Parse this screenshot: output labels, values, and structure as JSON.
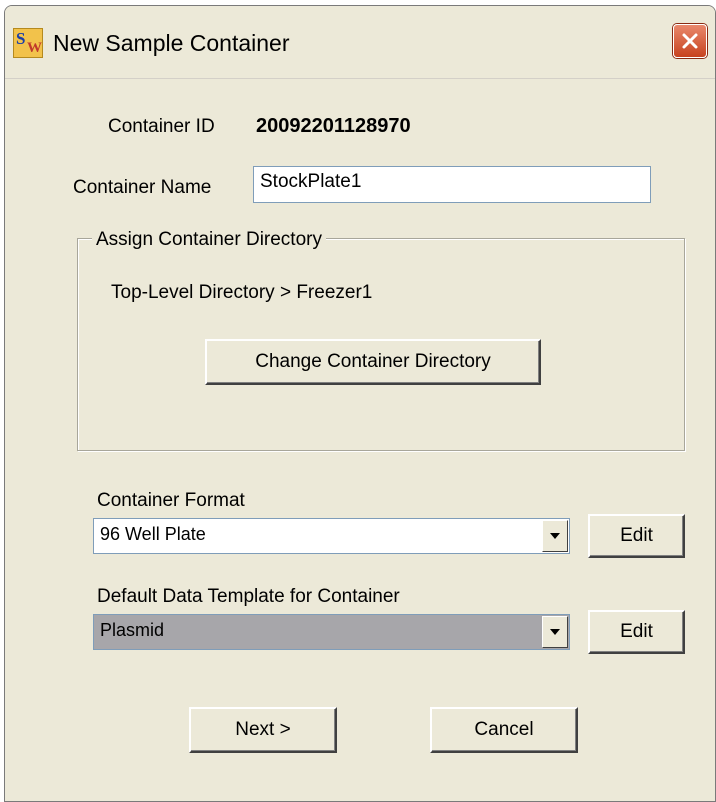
{
  "window": {
    "title": "New Sample Container",
    "icon": "sw-app-icon",
    "close_icon": "close-icon"
  },
  "container_id": {
    "label": "Container ID",
    "value": "20092201128970"
  },
  "container_name": {
    "label": "Container Name",
    "value": "StockPlate1"
  },
  "directory_group": {
    "legend": "Assign Container Directory",
    "path": "Top-Level Directory > Freezer1",
    "change_button": "Change Container Directory"
  },
  "container_format": {
    "label": "Container Format",
    "selected": "96 Well Plate",
    "edit_button": "Edit"
  },
  "data_template": {
    "label": "Default Data Template for Container",
    "selected": "Plasmid",
    "edit_button": "Edit"
  },
  "actions": {
    "next": "Next >",
    "cancel": "Cancel"
  },
  "colors": {
    "dialog_bg": "#ece9d8",
    "input_border": "#7f9db9",
    "close_red": "#c7421f",
    "disabled_combo_bg": "#a7a6aa"
  }
}
